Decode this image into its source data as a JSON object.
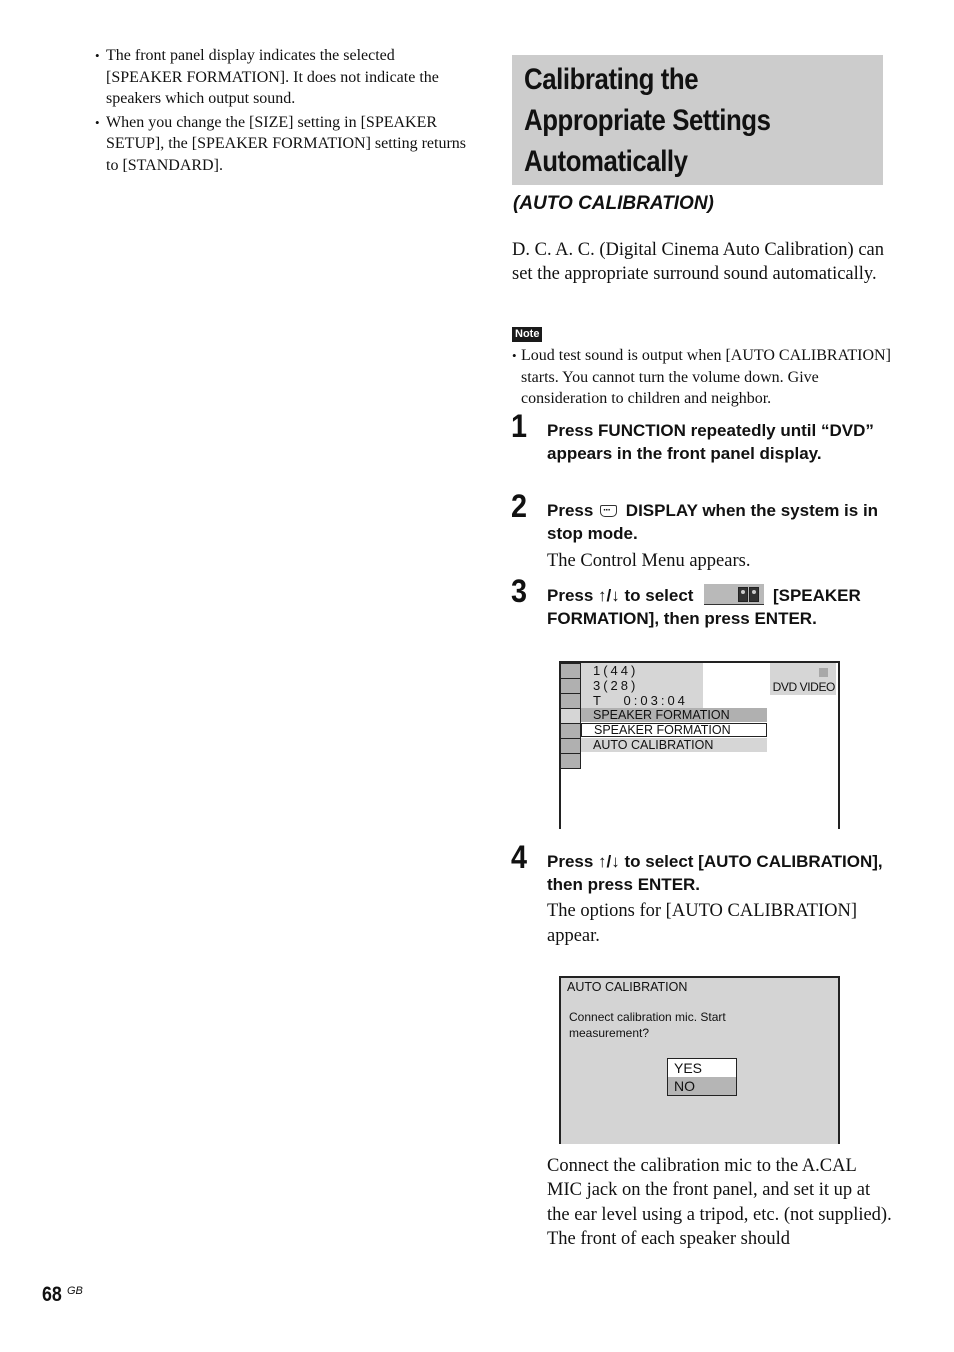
{
  "left_column": {
    "bullets": [
      "The front panel display indicates the selected [SPEAKER FORMATION]. It does not indicate the speakers which output sound.",
      "When you change the [SIZE] setting in [SPEAKER SETUP], the [SPEAKER FORMATION] setting returns to [STANDARD]."
    ]
  },
  "section": {
    "title_lines": [
      "Calibrating the",
      "Appropriate Settings",
      "Automatically"
    ],
    "subtitle": "(AUTO CALIBRATION)",
    "intro": "D. C. A. C. (Digital Cinema Auto Calibration) can set the appropriate surround sound automatically.",
    "note_label": "Note",
    "note_text": "Loud test sound is output when [AUTO CALIBRATION] starts. You cannot turn the volume down. Give consideration to children and neighbor."
  },
  "steps": [
    {
      "number": "1",
      "heading": "Press FUNCTION repeatedly until “DVD” appears in the front panel display."
    },
    {
      "number": "2",
      "heading_before_icon": "Press",
      "icon": "display-button-icon",
      "heading_after_icon": "DISPLAY when the system is in stop mode.",
      "body": "The Control Menu appears."
    },
    {
      "number": "3",
      "heading_before_icon": "Press ↑/↓ to select",
      "icon": "speaker-formation-icon",
      "heading_after_icon": "[SPEAKER FORMATION], then press ENTER."
    },
    {
      "number": "4",
      "heading": "Press ↑/↓ to select [AUTO CALIBRATION], then press ENTER.",
      "body": "The options for [AUTO CALIBRATION] appear."
    }
  ],
  "screen1": {
    "info_lines": [
      "1(44)",
      "3(28)",
      "T   0:03:04"
    ],
    "disc_type": "DVD VIDEO",
    "menu_header": "SPEAKER FORMATION",
    "menu_options": [
      "SPEAKER FORMATION",
      "AUTO CALIBRATION"
    ],
    "selected_option": "SPEAKER FORMATION"
  },
  "screen2": {
    "title": "AUTO CALIBRATION",
    "message": "Connect calibration mic. Start measurement?",
    "options": [
      "YES",
      "NO"
    ],
    "selected_option": "YES"
  },
  "continuation_text": "Connect the calibration mic to the A.CAL MIC jack on the front panel, and set it up at the ear level using a tripod, etc. (not supplied). The front of each speaker should",
  "footer": {
    "page_number": "68",
    "page_suffix": "GB"
  }
}
